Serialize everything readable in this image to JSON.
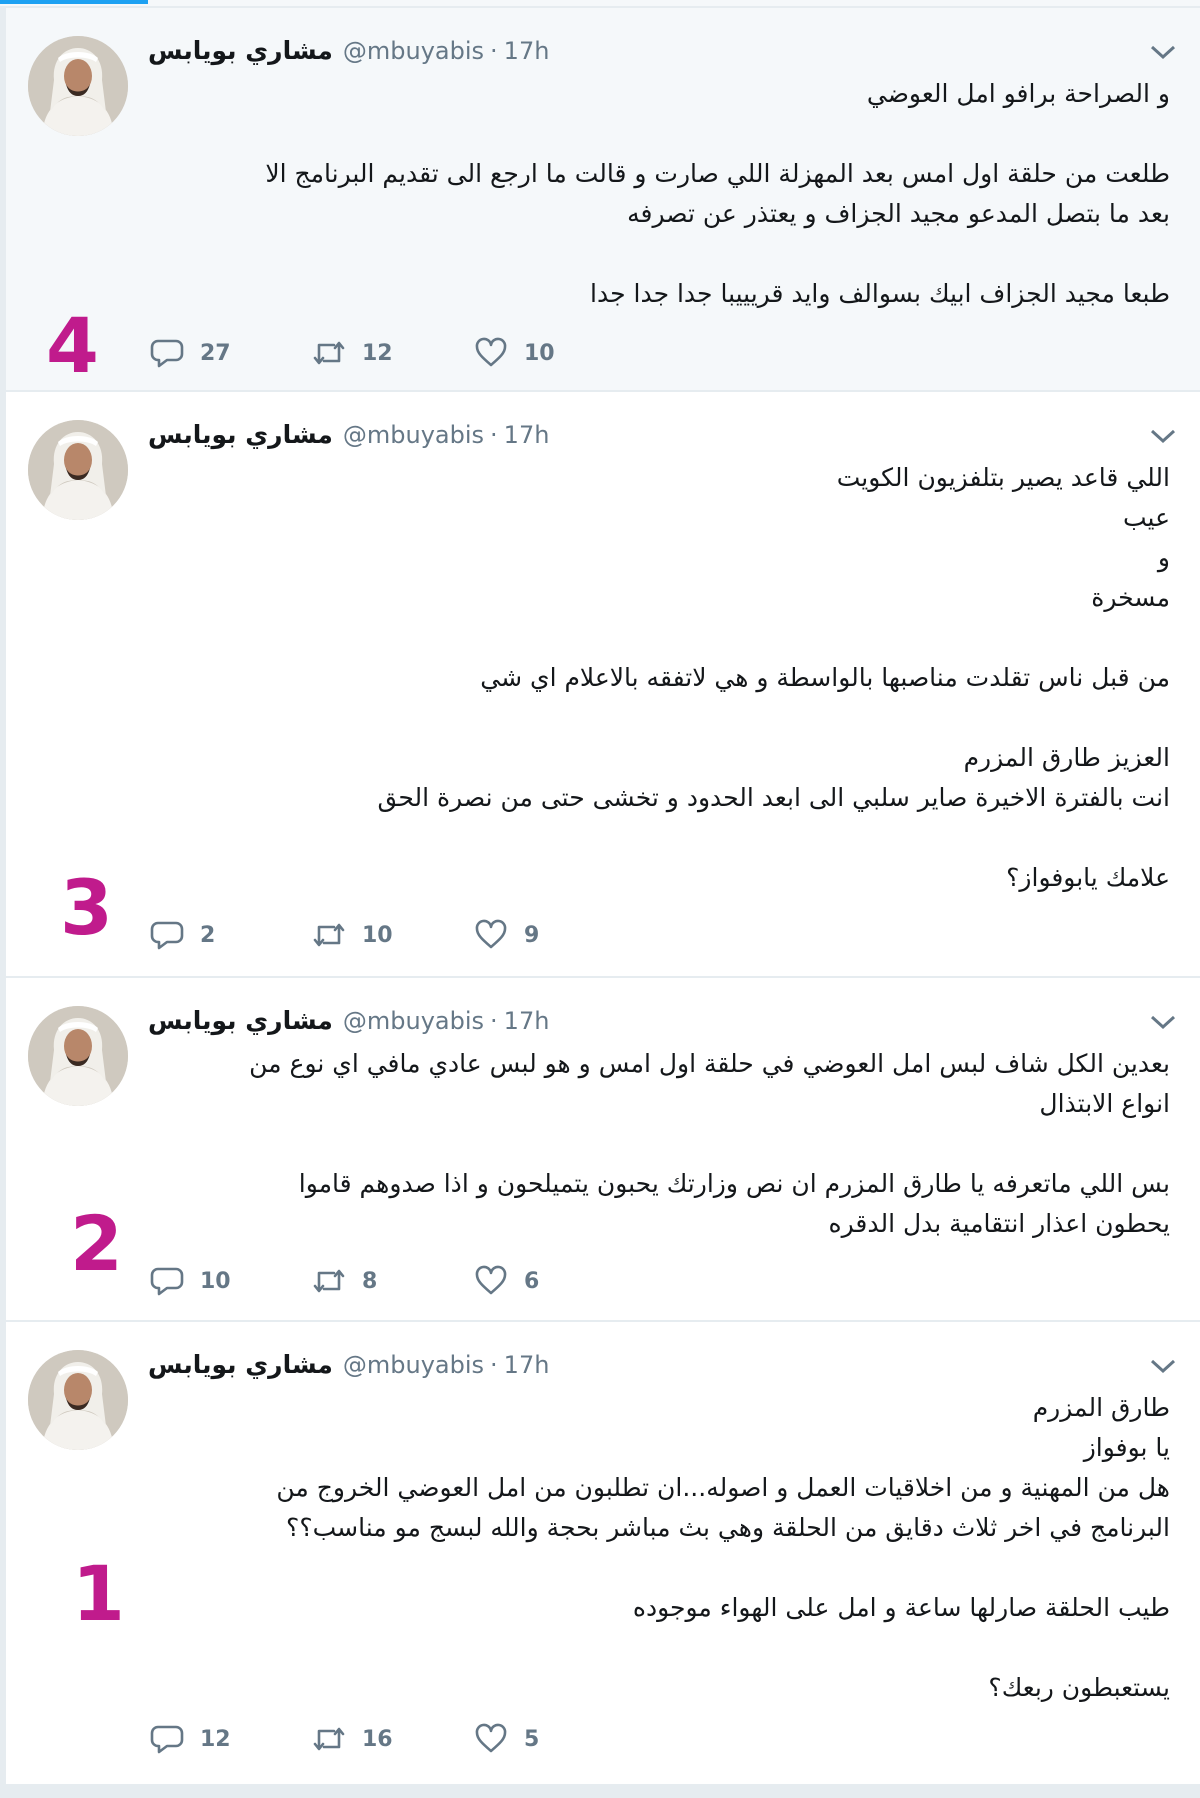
{
  "colors": {
    "accent": "#1da1f2",
    "annotation": "#c01b8c",
    "muted": "#657786",
    "text": "#14171a"
  },
  "icons": {
    "reply": "reply-icon",
    "retweet": "retweet-icon",
    "like": "heart-icon",
    "menu": "chevron-down-icon"
  },
  "tweets": [
    {
      "name": "مشاري بويابس",
      "handle": "@mbuyabis",
      "dot": "·",
      "time": "17h",
      "annotation": "4",
      "lines": [
        "و الصراحة برافو امل العوضي",
        "",
        "طلعت من حلقة اول امس بعد المهزلة اللي صارت و قالت ما ارجع الى تقديم البرنامج الا",
        "بعد ما بتصل المدعو مجيد الجزاف و يعتذر عن تصرفه",
        "",
        "طبعا مجيد الجزاف ابيك بسوالف وايد قريييبا جدا جدا جدا"
      ],
      "replies": "27",
      "retweets": "12",
      "likes": "10"
    },
    {
      "name": "مشاري بويابس",
      "handle": "@mbuyabis",
      "dot": "·",
      "time": "17h",
      "annotation": "3",
      "lines": [
        "اللي قاعد يصير بتلفزيون الكويت",
        "عيب",
        "و",
        "مسخرة",
        "",
        "من قبل ناس تقلدت مناصبها بالواسطة و هي لاتفقه بالاعلام اي شي",
        "",
        "العزيز طارق المزرم",
        "انت بالفترة الاخيرة صاير سلبي الى ابعد الحدود و تخشى حتى من نصرة الحق",
        "",
        "علامك يابوفواز؟"
      ],
      "replies": "2",
      "retweets": "10",
      "likes": "9"
    },
    {
      "name": "مشاري بويابس",
      "handle": "@mbuyabis",
      "dot": "·",
      "time": "17h",
      "annotation": "2",
      "lines": [
        "بعدين الكل شاف لبس امل العوضي في حلقة اول امس و هو لبس عادي مافي اي نوع من",
        "انواع الابتذال",
        "",
        "بس اللي ماتعرفه يا طارق المزرم ان نص وزارتك يحبون يتميلحون و اذا صدوهم قاموا",
        "يحطون اعذار انتقامية بدل الدقره"
      ],
      "replies": "10",
      "retweets": "8",
      "likes": "6"
    },
    {
      "name": "مشاري بويابس",
      "handle": "@mbuyabis",
      "dot": "·",
      "time": "17h",
      "annotation": "1",
      "lines": [
        "طارق المزرم",
        "يا بوفواز",
        "هل من المهنية و من اخلاقيات العمل و اصوله...ان تطلبون من امل العوضي الخروج من",
        "البرنامج في اخر ثلاث دقايق من الحلقة وهي بث مباشر بحجة والله لبسج مو مناسب؟؟",
        "",
        "طيب الحلقة صارلها ساعة و امل على الهواء موجوده",
        "",
        "يستعبطون ربعك؟"
      ],
      "replies": "12",
      "retweets": "16",
      "likes": "5"
    }
  ]
}
